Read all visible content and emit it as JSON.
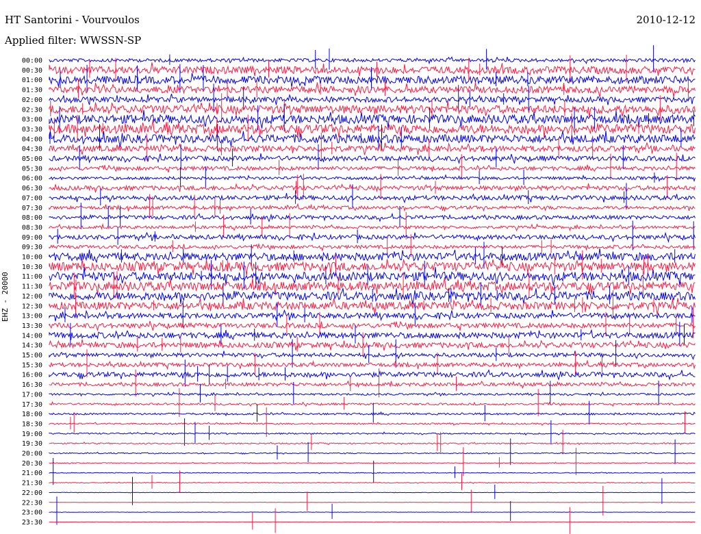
{
  "header": {
    "title": "HT Santorini - Vourvoulos",
    "date": "2010-12-12",
    "filter": "Applied filter: WWSSN-SP",
    "channel": "EHZ - 20000"
  },
  "colors": {
    "blue": "#0000ee",
    "red": "#ff1a40"
  },
  "chart_data": {
    "type": "line",
    "title": "HT Santorini - Vourvoulos",
    "ylabel": "EHZ - 20000",
    "xlabel": "",
    "grid": false,
    "rows": [
      "00:00",
      "00:30",
      "01:00",
      "01:30",
      "02:00",
      "02:30",
      "03:00",
      "03:30",
      "04:00",
      "04:30",
      "05:00",
      "05:30",
      "06:00",
      "06:30",
      "07:00",
      "07:30",
      "08:00",
      "08:30",
      "09:00",
      "09:30",
      "10:00",
      "10:30",
      "11:00",
      "11:30",
      "12:00",
      "12:30",
      "13:00",
      "13:30",
      "14:00",
      "14:30",
      "15:00",
      "15:30",
      "16:00",
      "16:30",
      "17:00",
      "17:30",
      "18:00",
      "18:30",
      "19:00",
      "19:30",
      "20:00",
      "20:30",
      "21:00",
      "21:30",
      "22:00",
      "22:30",
      "23:00",
      "23:30"
    ],
    "row_colors": [
      "blue",
      "red",
      "blue",
      "red",
      "blue",
      "red",
      "blue",
      "red",
      "blue",
      "red",
      "blue",
      "red",
      "blue",
      "red",
      "blue",
      "red",
      "blue",
      "red",
      "blue",
      "red",
      "blue",
      "red",
      "blue",
      "red",
      "blue",
      "red",
      "blue",
      "red",
      "blue",
      "red",
      "blue",
      "red",
      "blue",
      "red",
      "blue",
      "red",
      "blue",
      "red",
      "blue",
      "red",
      "blue",
      "red",
      "blue",
      "red",
      "blue",
      "red",
      "blue",
      "red"
    ],
    "noise_level": [
      0.35,
      0.75,
      0.8,
      0.7,
      0.55,
      0.85,
      0.9,
      0.95,
      0.85,
      0.6,
      0.5,
      0.4,
      0.3,
      0.45,
      0.45,
      0.35,
      0.4,
      0.3,
      0.45,
      0.35,
      0.8,
      0.9,
      0.9,
      0.9,
      0.85,
      0.8,
      0.55,
      0.5,
      0.6,
      0.55,
      0.4,
      0.4,
      0.5,
      0.35,
      0.2,
      0.2,
      0.2,
      0.15,
      0.15,
      0.12,
      0.1,
      0.08,
      0.07,
      0.07,
      0.04,
      0.03,
      0.03,
      0.03
    ]
  }
}
